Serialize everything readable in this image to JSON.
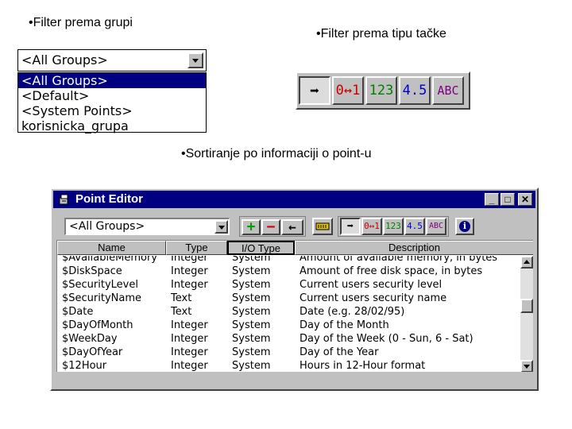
{
  "captions": {
    "group_filter": "•Filter prema grupi",
    "type_filter": "•Filter prema tipu tačke",
    "sorting": "•Sortiranje po informaciji o point-u"
  },
  "group_dropdown": {
    "selected": "<All Groups>",
    "options": [
      "<All Groups>",
      "<Default>",
      "<System Points>",
      "korisnicka_grupa"
    ]
  },
  "type_filter_buttons": [
    {
      "icon": "arrow-right-icon",
      "label": "➡",
      "color": "#000000"
    },
    {
      "icon": "digital-icon",
      "label": "0↔1",
      "color": "#cc0000"
    },
    {
      "icon": "integer-icon",
      "label": "123",
      "color": "#008000"
    },
    {
      "icon": "real-icon",
      "label": "4.5",
      "color": "#0000cc"
    },
    {
      "icon": "text-icon",
      "label": "ABC",
      "color": "#800080"
    }
  ],
  "window": {
    "title": "Point Editor",
    "group_selected": "<All Groups>",
    "toolbar": {
      "add": "+",
      "remove": "−",
      "back": "←",
      "info": "i"
    },
    "columns": [
      "Name",
      "Type",
      "I/O Type",
      "Description"
    ],
    "rows": [
      [
        "$AvailableMemory",
        "Integer",
        "System",
        "Amount of available memory, in bytes"
      ],
      [
        "$DiskSpace",
        "Integer",
        "System",
        "Amount of free disk space, in bytes"
      ],
      [
        "$SecurityLevel",
        "Integer",
        "System",
        "Current users security level"
      ],
      [
        "$SecurityName",
        "Text",
        "System",
        "Current users security name"
      ],
      [
        "$Date",
        "Text",
        "System",
        "Date (e.g. 28/02/95)"
      ],
      [
        "$DayOfMonth",
        "Integer",
        "System",
        "Day of the Month"
      ],
      [
        "$WeekDay",
        "Integer",
        "System",
        "Day of the Week (0 - Sun, 6 - Sat)"
      ],
      [
        "$DayOfYear",
        "Integer",
        "System",
        "Day of the Year"
      ],
      [
        "$12Hour",
        "Integer",
        "System",
        "Hours in 12-Hour format"
      ]
    ]
  }
}
